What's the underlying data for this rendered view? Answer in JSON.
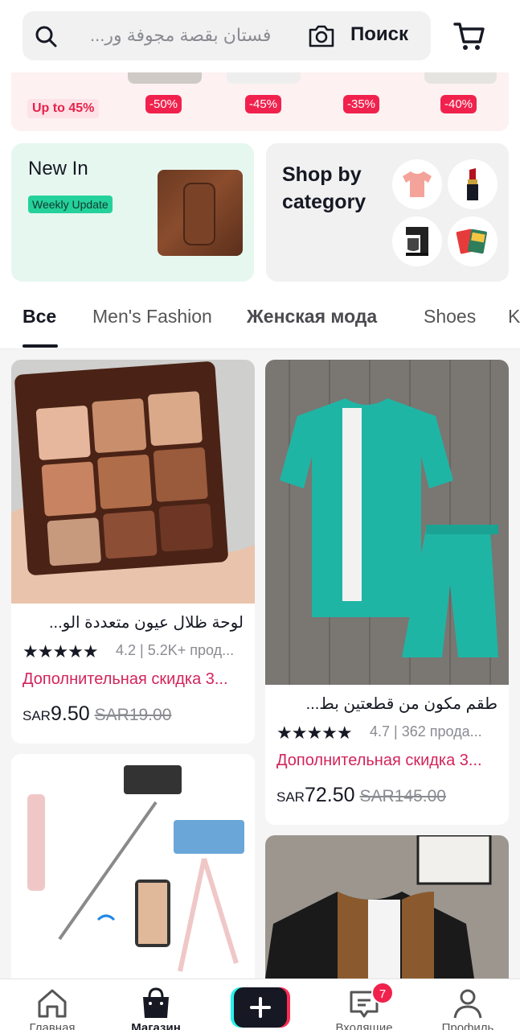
{
  "search": {
    "placeholder": "فستان بقصة مجوفة ور...",
    "button_label": "Поиск"
  },
  "sale_banner": {
    "upto_label": "Up to 45%",
    "discounts": [
      "-50%",
      "-45%",
      "-35%",
      "-40%"
    ]
  },
  "new_in": {
    "title": "New In",
    "badge": "Weekly Update"
  },
  "shop_by_category": {
    "title": "Shop by category",
    "icons": [
      "tshirt-icon",
      "lipstick-icon",
      "coffee-maker-icon",
      "cards-icon"
    ]
  },
  "tabs": [
    {
      "label": "Все",
      "active": true
    },
    {
      "label": "Men's Fashion"
    },
    {
      "label": "Женская мода"
    },
    {
      "label": "Shoes"
    },
    {
      "label": "K"
    }
  ],
  "products": [
    {
      "name": "لوحة ظلال عيون متعددة الو...",
      "stars": "★★★★★",
      "rating": "4.2",
      "sold": "5.2K+ прод...",
      "promo": "Дополнительная скидка 3...",
      "currency": "SAR",
      "price": "9.50",
      "old_price": "SAR19.00"
    },
    {
      "name": "طقم مكون من قطعتين بط...",
      "stars": "★★★★★",
      "rating": "4.7",
      "sold": "362 прода...",
      "promo": "Дополнительная скидка 3...",
      "currency": "SAR",
      "price": "72.50",
      "old_price": "SAR145.00"
    }
  ],
  "bottom_nav": {
    "home": "Главная",
    "shop": "Магазин",
    "inbox": "Входящие",
    "profile": "Профиль",
    "inbox_badge": "7"
  },
  "colors": {
    "accent_red": "#f0224d",
    "promo_pink": "#d3245b",
    "new_in_bg": "#e6f7f0",
    "badge_green": "#25d19b"
  }
}
